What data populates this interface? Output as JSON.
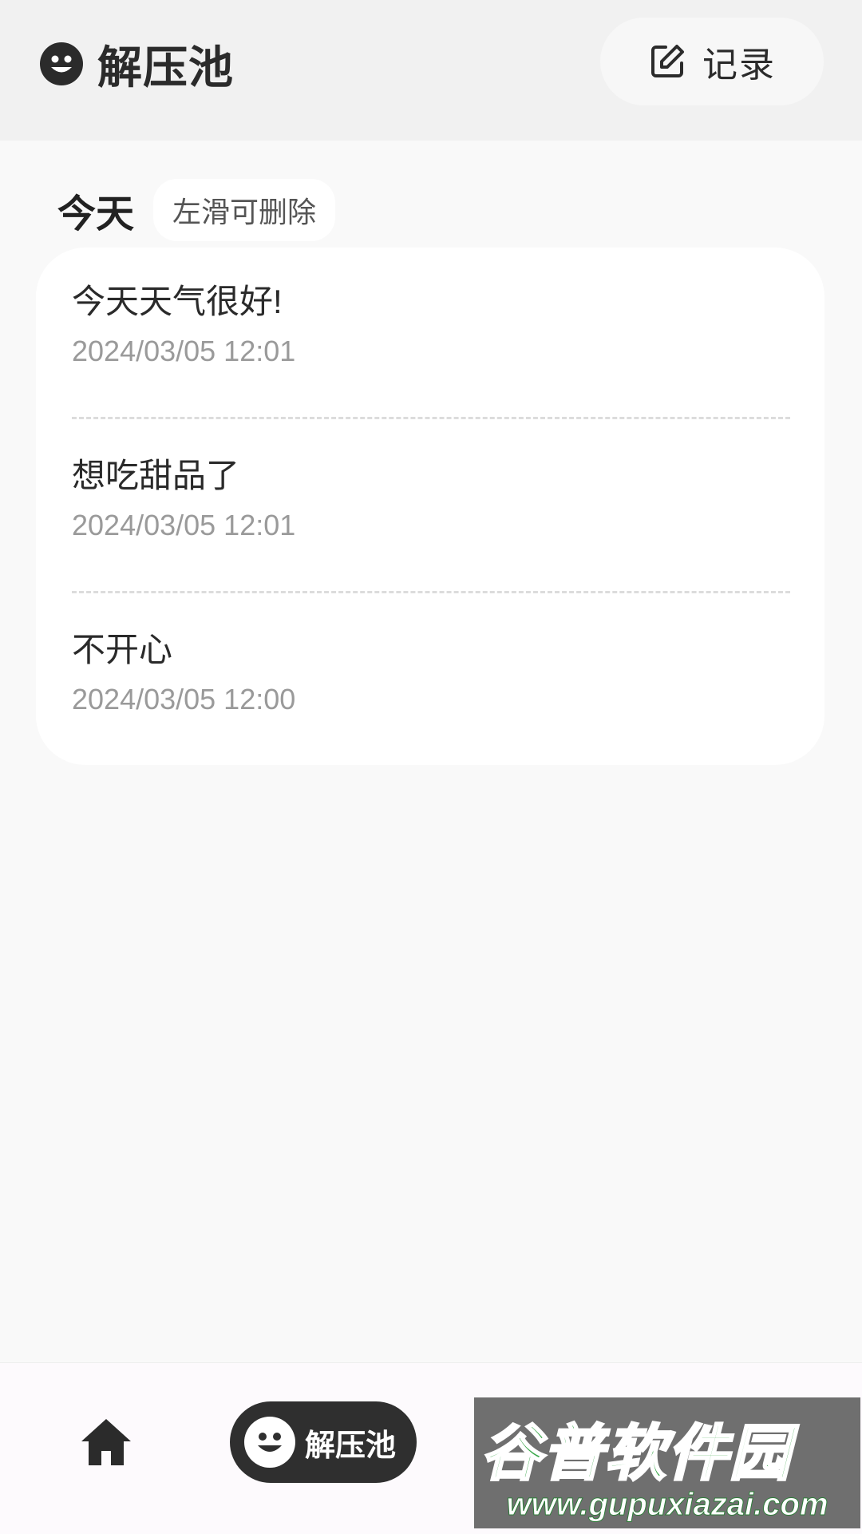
{
  "header": {
    "title": "解压池",
    "record_button_label": "记录"
  },
  "section": {
    "title": "今天",
    "hint": "左滑可删除"
  },
  "entries": [
    {
      "text": "今天天气很好!",
      "time": "2024/03/05 12:01"
    },
    {
      "text": "想吃甜品了",
      "time": "2024/03/05 12:01"
    },
    {
      "text": "不开心",
      "time": "2024/03/05 12:00"
    }
  ],
  "bottom_nav": {
    "active_label": "解压池"
  },
  "watermark": {
    "name": "谷普软件园",
    "url": "www.gupuxiazai.com"
  },
  "colors": {
    "accent_dark": "#2f2f2f",
    "background": "#f9f9f9",
    "watermark_green": "#3aa84a"
  },
  "icons": [
    "smiley-icon",
    "edit-icon",
    "home-icon"
  ]
}
